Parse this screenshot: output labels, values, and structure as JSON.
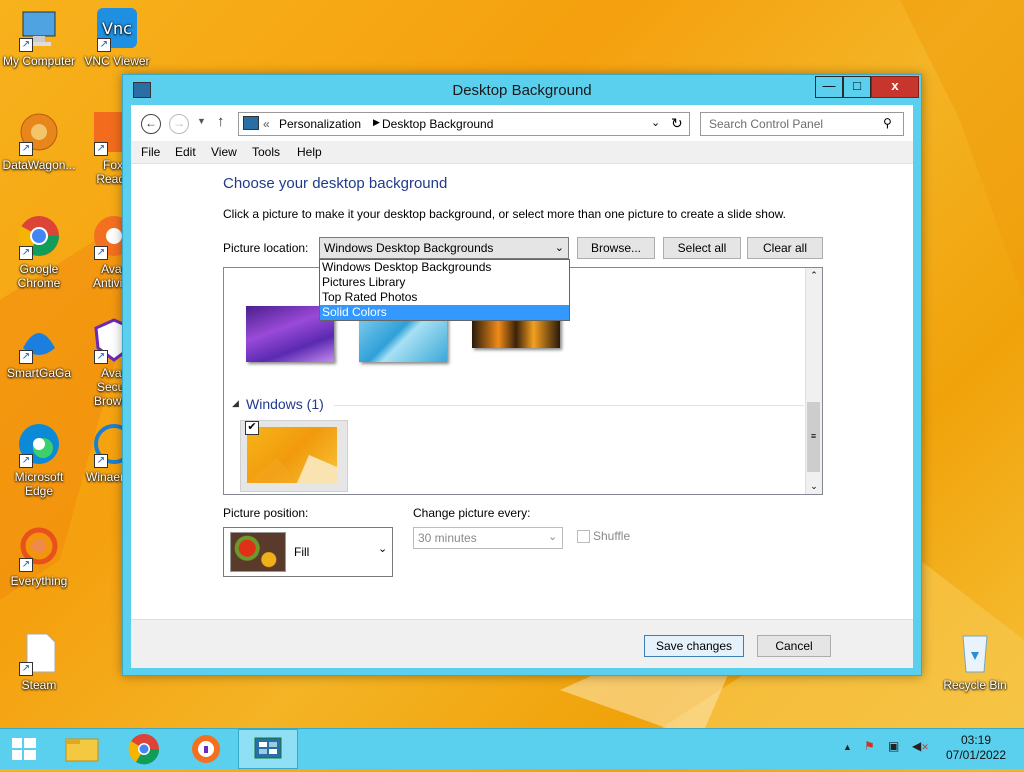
{
  "desktop": {
    "icons": [
      {
        "label": "My Computer"
      },
      {
        "label": "VNC Viewer"
      },
      {
        "label": "DataWagon..."
      },
      {
        "label": "Foxit Reader"
      },
      {
        "label": "Google Chrome"
      },
      {
        "label": "Avast Antivirus"
      },
      {
        "label": "SmartGaGa"
      },
      {
        "label": "Avast Secure Browser"
      },
      {
        "label": "Microsoft Edge"
      },
      {
        "label": "WinaeroTweaker"
      },
      {
        "label": "Everything"
      },
      {
        "label": "Steam"
      },
      {
        "label": "Recycle Bin"
      }
    ]
  },
  "window": {
    "title": "Desktop Background",
    "buttons": {
      "minimize": "—",
      "maximize": "□",
      "close": "x"
    }
  },
  "nav": {
    "back": "←",
    "forward": "→",
    "up": "↑",
    "breadcrumb_prefix": "«",
    "breadcrumb": [
      "Personalization",
      "Desktop Background"
    ],
    "search_placeholder": "Search Control Panel"
  },
  "menu": [
    "File",
    "Edit",
    "View",
    "Tools",
    "Help"
  ],
  "main": {
    "heading": "Choose your desktop background",
    "description": "Click a picture to make it your desktop background, or select more than one picture to create a slide show.",
    "picture_location_label": "Picture location:",
    "picture_location_value": "Windows Desktop Backgrounds",
    "browse": "Browse...",
    "select_all": "Select all",
    "clear_all": "Clear all",
    "dropdown_options": [
      "Windows Desktop Backgrounds",
      "Pictures Library",
      "Top Rated Photos",
      "Solid Colors"
    ],
    "dropdown_selected_index": 3,
    "group_title": "Windows (1)",
    "picture_position_label": "Picture position:",
    "picture_position_value": "Fill",
    "change_every_label": "Change picture every:",
    "change_every_value": "30 minutes",
    "shuffle_label": "Shuffle"
  },
  "footer": {
    "save": "Save changes",
    "cancel": "Cancel"
  },
  "taskbar": {
    "time": "03:19",
    "date": "07/01/2022"
  },
  "colors": {
    "accent": "#5bd0ee",
    "heading": "#1f3b8a",
    "selection": "#3399ff",
    "close": "#c7362c"
  }
}
